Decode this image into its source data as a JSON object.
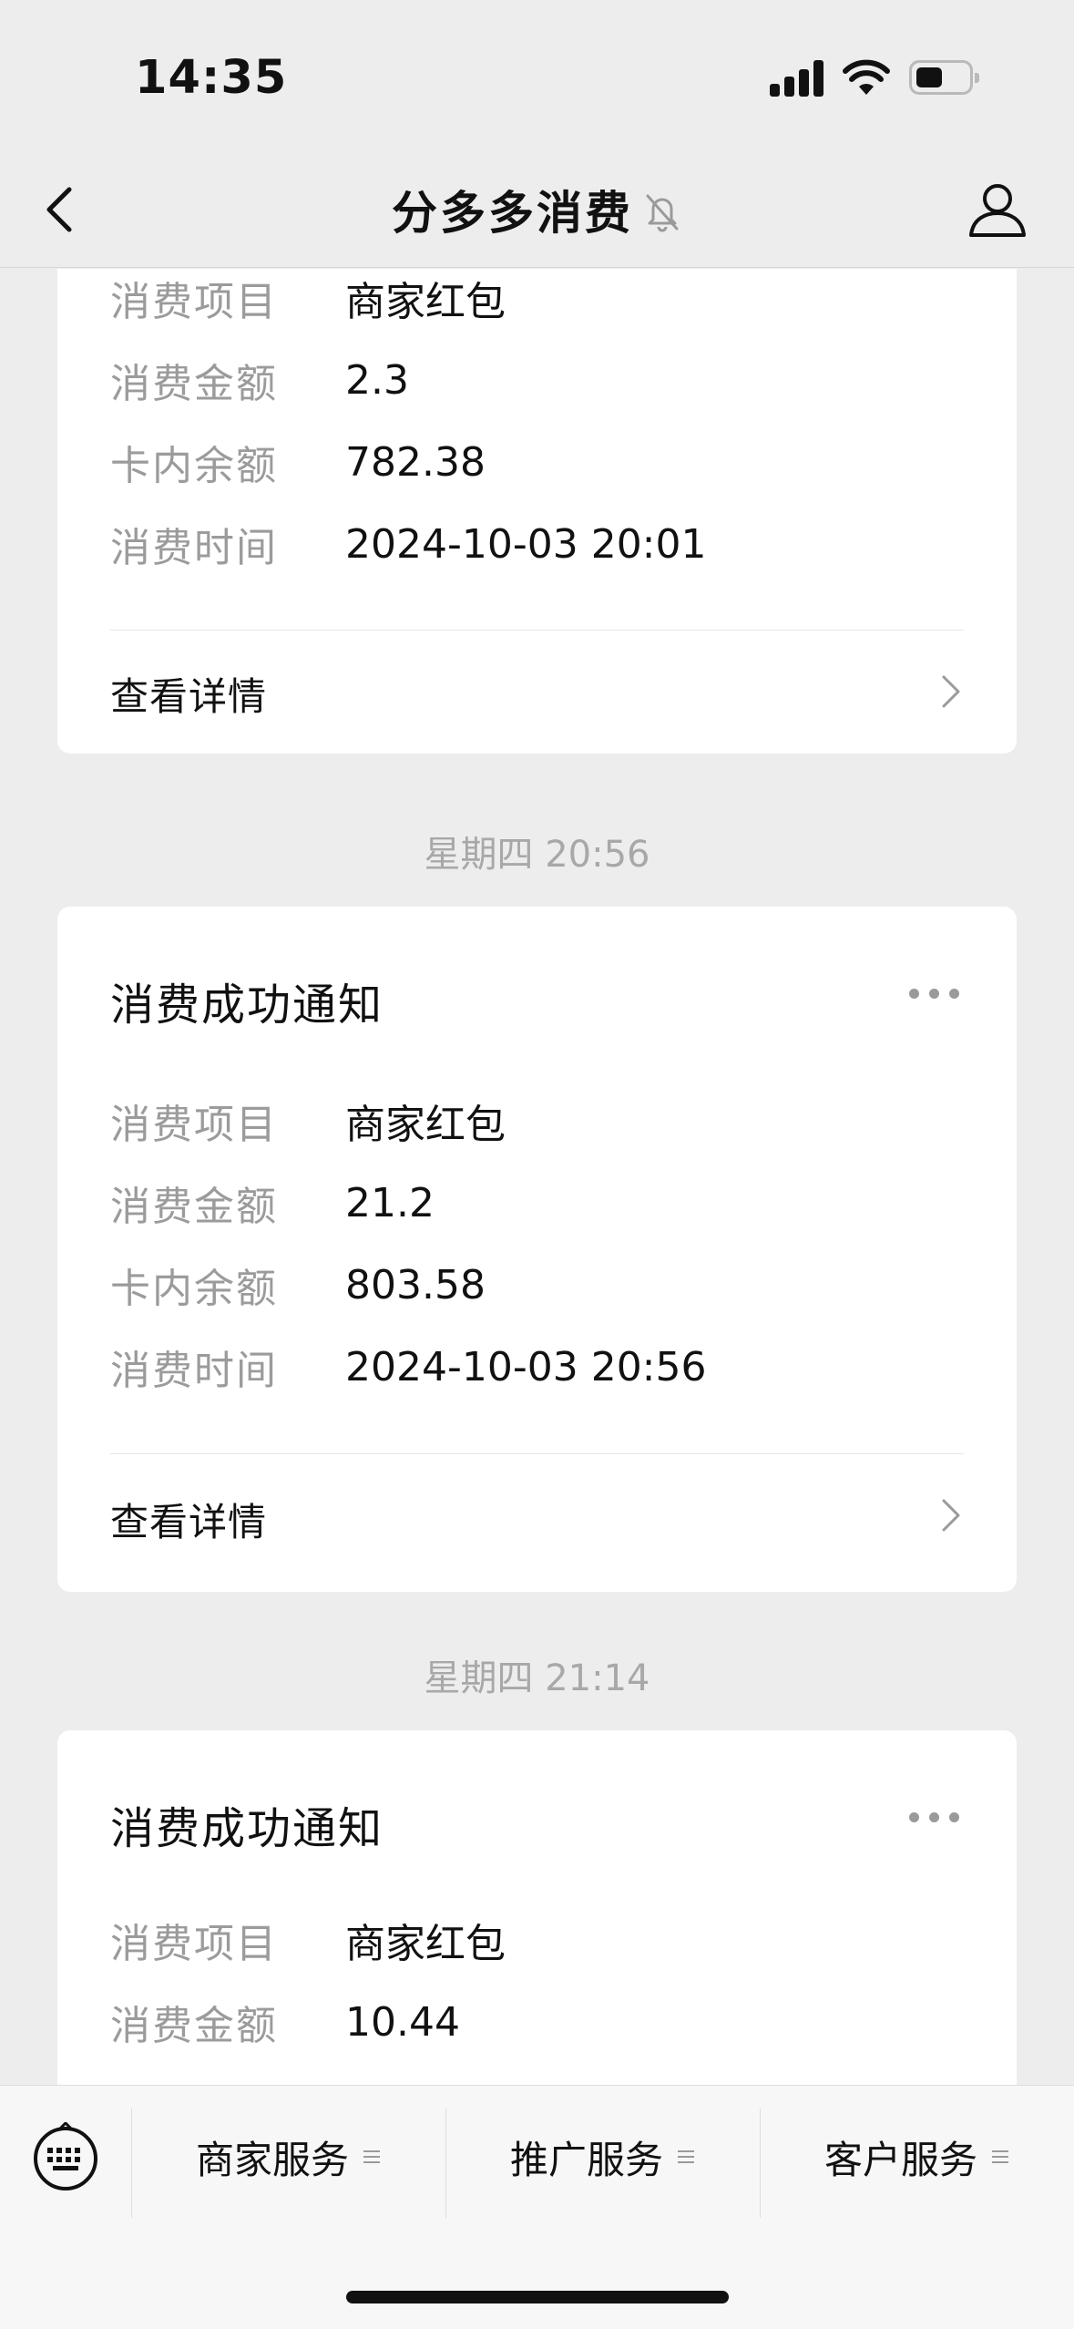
{
  "status_bar": {
    "time": "14:35"
  },
  "nav": {
    "title": "分多多消费"
  },
  "cards": [
    {
      "rows": [
        {
          "label": "消费项目",
          "value": "商家红包"
        },
        {
          "label": "消费金额",
          "value": "2.3"
        },
        {
          "label": "卡内余额",
          "value": "782.38"
        },
        {
          "label": "消费时间",
          "value": "2024-10-03 20:01"
        }
      ],
      "detail_label": "查看详情"
    },
    {
      "timestamp": "星期四 20:56",
      "title": "消费成功通知",
      "rows": [
        {
          "label": "消费项目",
          "value": "商家红包"
        },
        {
          "label": "消费金额",
          "value": "21.2"
        },
        {
          "label": "卡内余额",
          "value": "803.58"
        },
        {
          "label": "消费时间",
          "value": "2024-10-03 20:56"
        }
      ],
      "detail_label": "查看详情"
    },
    {
      "timestamp": "星期四 21:14",
      "title": "消费成功通知",
      "rows": [
        {
          "label": "消费项目",
          "value": "商家红包"
        },
        {
          "label": "消费金额",
          "value": "10.44"
        }
      ]
    }
  ],
  "menu": {
    "items": [
      {
        "label": "商家服务"
      },
      {
        "label": "推广服务"
      },
      {
        "label": "客户服务"
      }
    ]
  },
  "icons": {
    "back": "chevron-left-icon",
    "mute": "bell-slash-icon",
    "profile": "person-icon",
    "more": "ellipsis-icon",
    "keyboard": "keyboard-icon"
  }
}
